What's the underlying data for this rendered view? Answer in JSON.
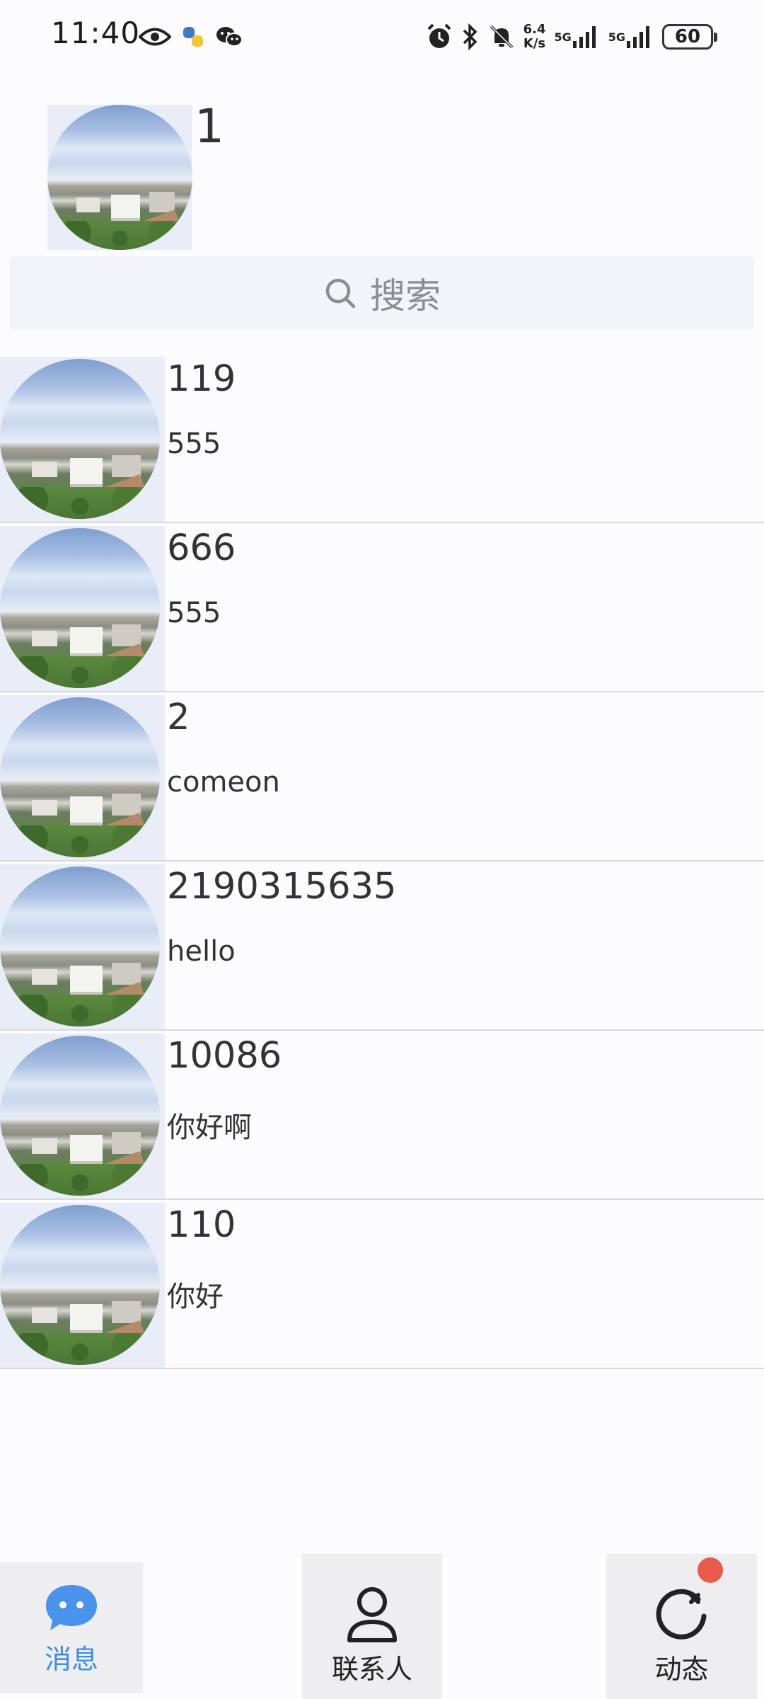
{
  "status_bar": {
    "time": "11:40",
    "net_speed_value": "6.4",
    "net_speed_unit": "K/s",
    "sim1": "5G",
    "sim2": "5G",
    "battery": "60"
  },
  "header": {
    "title": "1"
  },
  "search": {
    "placeholder": "搜索"
  },
  "chats": [
    {
      "name": "119",
      "message": "555"
    },
    {
      "name": "666",
      "message": "555"
    },
    {
      "name": "2",
      "message": "comeon"
    },
    {
      "name": "2190315635",
      "message": "hello"
    },
    {
      "name": "10086",
      "message": "你好啊"
    },
    {
      "name": "110",
      "message": "你好"
    }
  ],
  "bottom_nav": {
    "messages_label": "消息",
    "contacts_label": "联系人",
    "moments_label": "动态",
    "active": "messages",
    "active_color": "#3c8ce8",
    "badge_color": "#e85b4a"
  }
}
